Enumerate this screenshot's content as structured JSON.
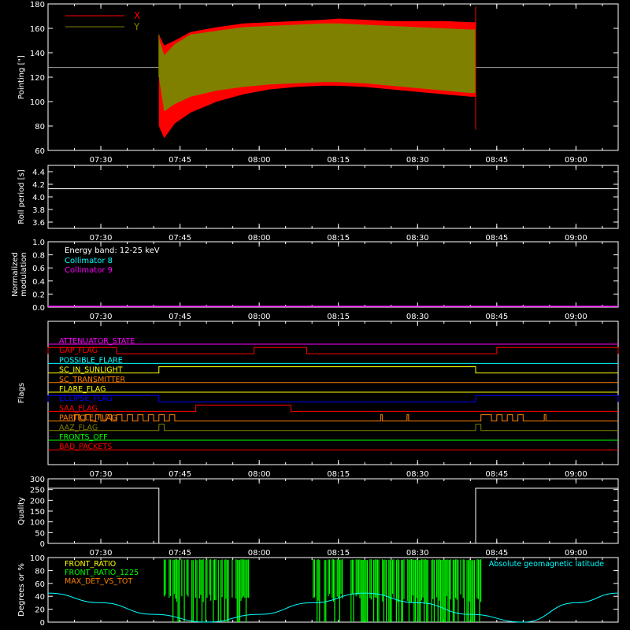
{
  "chart_data": [
    {
      "type": "line",
      "ylabel": "Pointing [\"]",
      "ylim": [
        60,
        180
      ],
      "yticks": [
        60,
        80,
        100,
        120,
        140,
        160,
        180
      ],
      "xlim": [
        "07:20",
        "09:08"
      ],
      "xticks": [
        "07:30",
        "07:45",
        "08:00",
        "08:15",
        "08:30",
        "08:45",
        "09:00"
      ],
      "legend": "top-left",
      "reference_line": 128,
      "series": [
        {
          "name": "X",
          "color": "#ff0000",
          "x": [
            "07:41",
            "07:42",
            "07:44",
            "07:47",
            "07:52",
            "07:57",
            "08:02",
            "08:07",
            "08:12",
            "08:15",
            "08:20",
            "08:25",
            "08:30",
            "08:35",
            "08:40",
            "08:41"
          ],
          "upper": [
            155,
            146,
            150,
            157,
            161,
            164,
            165,
            166,
            167,
            168,
            167,
            166,
            166,
            166,
            165,
            165
          ],
          "lower": [
            80,
            70,
            82,
            91,
            100,
            106,
            110,
            112,
            113,
            113,
            112,
            110,
            108,
            106,
            104,
            104
          ]
        },
        {
          "name": "Y",
          "color": "#808000",
          "x": [
            "07:41",
            "07:42",
            "07:44",
            "07:47",
            "07:52",
            "07:57",
            "08:02",
            "08:07",
            "08:12",
            "08:15",
            "08:20",
            "08:25",
            "08:30",
            "08:35",
            "08:40",
            "08:41"
          ],
          "upper": [
            152,
            138,
            147,
            155,
            158,
            161,
            162,
            163,
            164,
            164,
            163,
            162,
            161,
            160,
            159,
            159
          ],
          "lower": [
            120,
            92,
            98,
            104,
            109,
            112,
            114,
            115,
            116,
            116,
            115,
            113,
            111,
            109,
            107,
            107
          ]
        }
      ]
    },
    {
      "type": "line",
      "ylabel": "Roll period [s]",
      "ylim": [
        3.5,
        4.5
      ],
      "yticks": [
        "3.6",
        "3.8",
        "4.0",
        "4.2",
        "4.4"
      ],
      "xticks": [
        "07:30",
        "07:45",
        "08:00",
        "08:15",
        "08:30",
        "08:45",
        "09:00"
      ],
      "series": [
        {
          "name": "",
          "color": "#ffffff",
          "x": [
            "07:20",
            "09:08"
          ],
          "values": [
            4.13,
            4.13
          ]
        }
      ]
    },
    {
      "type": "line",
      "ylabel": "Normalized modulation",
      "ylim": [
        0,
        1
      ],
      "yticks": [
        "0.0",
        "0.2",
        "0.4",
        "0.6",
        "0.8",
        "1.0"
      ],
      "xticks": [
        "07:30",
        "07:45",
        "08:00",
        "08:15",
        "08:30",
        "08:45",
        "09:00"
      ],
      "annotation": "Energy band: 12-25 keV",
      "series": [
        {
          "name": "Collimator 8",
          "color": "#00ffff",
          "x": [
            "07:20",
            "09:08"
          ],
          "values": [
            0,
            0
          ]
        },
        {
          "name": "Collimator 9",
          "color": "#ff00ff",
          "x": [
            "07:20",
            "09:08"
          ],
          "values": [
            0,
            0
          ]
        }
      ]
    },
    {
      "type": "line",
      "ylabel": "Flags",
      "xticks": [
        "07:30",
        "07:45",
        "08:00",
        "08:15",
        "08:30",
        "08:45",
        "09:00"
      ],
      "flags": [
        {
          "name": "ATTENUATOR_STATE",
          "color": "#ff00ff",
          "on": []
        },
        {
          "name": "GAP_FLAG",
          "color": "#ff0000",
          "on": [
            [
              "07:20",
              "07:33"
            ],
            [
              "07:59",
              "08:09"
            ],
            [
              "08:45",
              "09:08"
            ]
          ]
        },
        {
          "name": "POSSIBLE_FLARE",
          "color": "#00ffff",
          "on": []
        },
        {
          "name": "SC_IN_SUNLIGHT",
          "color": "#ffff00",
          "on": [
            [
              "07:41",
              "08:41"
            ]
          ]
        },
        {
          "name": "SC_TRANSMITTER",
          "color": "#ff8000",
          "on": []
        },
        {
          "name": "FLARE_FLAG",
          "color": "#ffff00",
          "on": []
        },
        {
          "name": "ECLIPSE_FLAG",
          "color": "#0000ff",
          "on": [
            [
              "07:20",
              "07:41"
            ],
            [
              "08:41",
              "09:08"
            ]
          ]
        },
        {
          "name": "SAA_FLAG",
          "color": "#ff0000",
          "on": [
            [
              "07:48",
              "08:06"
            ]
          ]
        },
        {
          "name": "PARTICLE_FLAG",
          "color": "#ff8000",
          "on": [
            [
              "07:25",
              "07:26"
            ],
            [
              "07:27",
              "07:28"
            ],
            [
              "07:29",
              "07:30"
            ],
            [
              "07:31",
              "07:32"
            ],
            [
              "07:33",
              "07:34"
            ],
            [
              "07:35",
              "07:36"
            ],
            [
              "07:37",
              "07:38"
            ],
            [
              "07:39",
              "07:40"
            ],
            [
              "07:41",
              "07:42"
            ],
            [
              "07:43",
              "07:44"
            ],
            [
              "08:23",
              "08:23.3"
            ],
            [
              "08:28",
              "08:28.3"
            ],
            [
              "08:42",
              "08:44"
            ],
            [
              "08:45",
              "08:46"
            ],
            [
              "08:47",
              "08:48"
            ],
            [
              "08:49",
              "08:50"
            ],
            [
              "08:54",
              "08:54.3"
            ]
          ]
        },
        {
          "name": "AAZ_FLAG",
          "color": "#808000",
          "on": [
            [
              "07:41",
              "07:42"
            ],
            [
              "08:41",
              "08:42"
            ]
          ]
        },
        {
          "name": "FRONTS_OFF",
          "color": "#00ff00",
          "on": []
        },
        {
          "name": "BAD_PACKETS",
          "color": "#ff0000",
          "on": []
        }
      ]
    },
    {
      "type": "line",
      "ylabel": "Quality",
      "ylim": [
        0,
        300
      ],
      "yticks": [
        0,
        50,
        100,
        150,
        200,
        250,
        300
      ],
      "xticks": [
        "07:30",
        "07:45",
        "08:00",
        "08:15",
        "08:30",
        "08:45",
        "09:00"
      ],
      "series": [
        {
          "name": "",
          "color": "#ffffff",
          "x": [
            "07:20",
            "07:41",
            "07:41",
            "08:41",
            "08:41",
            "09:08"
          ],
          "values": [
            256,
            256,
            0,
            0,
            256,
            256
          ]
        }
      ]
    },
    {
      "type": "line",
      "ylabel": "Degrees or %",
      "ylim": [
        0,
        100
      ],
      "yticks": [
        0,
        20,
        40,
        60,
        80,
        100
      ],
      "legend": "top-left",
      "annotation": "Absolute geomagnetic latitude",
      "series": [
        {
          "name": "FRONT_RATIO",
          "color": "#ffff00",
          "x": [],
          "values": []
        },
        {
          "name": "FRONT_RATIO_1225",
          "color": "#00ff00",
          "x": [],
          "values": [],
          "bursts": [
            [
              "07:42",
              "07:58"
            ],
            [
              "08:10",
              "08:42"
            ]
          ]
        },
        {
          "name": "MAX_DET_VS_TOT",
          "color": "#ff8000",
          "x": [],
          "values": []
        },
        {
          "name": "Absolute geomagnetic latitude",
          "color": "#00ffff",
          "x": [
            "07:20",
            "07:30",
            "07:40",
            "07:50",
            "08:00",
            "08:10",
            "08:20",
            "08:30",
            "08:40",
            "08:50",
            "09:00",
            "09:08"
          ],
          "values": [
            45,
            30,
            12,
            0,
            12,
            30,
            45,
            30,
            12,
            0,
            30,
            45
          ]
        }
      ]
    }
  ]
}
